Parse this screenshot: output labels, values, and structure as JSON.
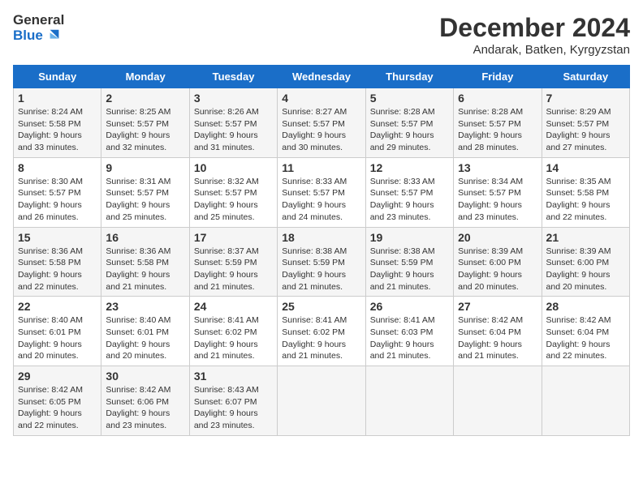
{
  "logo": {
    "line1": "General",
    "line2": "Blue"
  },
  "title": "December 2024",
  "location": "Andarak, Batken, Kyrgyzstan",
  "days_of_week": [
    "Sunday",
    "Monday",
    "Tuesday",
    "Wednesday",
    "Thursday",
    "Friday",
    "Saturday"
  ],
  "weeks": [
    [
      {
        "day": "1",
        "sunrise": "Sunrise: 8:24 AM",
        "sunset": "Sunset: 5:58 PM",
        "daylight": "Daylight: 9 hours and 33 minutes."
      },
      {
        "day": "2",
        "sunrise": "Sunrise: 8:25 AM",
        "sunset": "Sunset: 5:57 PM",
        "daylight": "Daylight: 9 hours and 32 minutes."
      },
      {
        "day": "3",
        "sunrise": "Sunrise: 8:26 AM",
        "sunset": "Sunset: 5:57 PM",
        "daylight": "Daylight: 9 hours and 31 minutes."
      },
      {
        "day": "4",
        "sunrise": "Sunrise: 8:27 AM",
        "sunset": "Sunset: 5:57 PM",
        "daylight": "Daylight: 9 hours and 30 minutes."
      },
      {
        "day": "5",
        "sunrise": "Sunrise: 8:28 AM",
        "sunset": "Sunset: 5:57 PM",
        "daylight": "Daylight: 9 hours and 29 minutes."
      },
      {
        "day": "6",
        "sunrise": "Sunrise: 8:28 AM",
        "sunset": "Sunset: 5:57 PM",
        "daylight": "Daylight: 9 hours and 28 minutes."
      },
      {
        "day": "7",
        "sunrise": "Sunrise: 8:29 AM",
        "sunset": "Sunset: 5:57 PM",
        "daylight": "Daylight: 9 hours and 27 minutes."
      }
    ],
    [
      {
        "day": "8",
        "sunrise": "Sunrise: 8:30 AM",
        "sunset": "Sunset: 5:57 PM",
        "daylight": "Daylight: 9 hours and 26 minutes."
      },
      {
        "day": "9",
        "sunrise": "Sunrise: 8:31 AM",
        "sunset": "Sunset: 5:57 PM",
        "daylight": "Daylight: 9 hours and 25 minutes."
      },
      {
        "day": "10",
        "sunrise": "Sunrise: 8:32 AM",
        "sunset": "Sunset: 5:57 PM",
        "daylight": "Daylight: 9 hours and 25 minutes."
      },
      {
        "day": "11",
        "sunrise": "Sunrise: 8:33 AM",
        "sunset": "Sunset: 5:57 PM",
        "daylight": "Daylight: 9 hours and 24 minutes."
      },
      {
        "day": "12",
        "sunrise": "Sunrise: 8:33 AM",
        "sunset": "Sunset: 5:57 PM",
        "daylight": "Daylight: 9 hours and 23 minutes."
      },
      {
        "day": "13",
        "sunrise": "Sunrise: 8:34 AM",
        "sunset": "Sunset: 5:57 PM",
        "daylight": "Daylight: 9 hours and 23 minutes."
      },
      {
        "day": "14",
        "sunrise": "Sunrise: 8:35 AM",
        "sunset": "Sunset: 5:58 PM",
        "daylight": "Daylight: 9 hours and 22 minutes."
      }
    ],
    [
      {
        "day": "15",
        "sunrise": "Sunrise: 8:36 AM",
        "sunset": "Sunset: 5:58 PM",
        "daylight": "Daylight: 9 hours and 22 minutes."
      },
      {
        "day": "16",
        "sunrise": "Sunrise: 8:36 AM",
        "sunset": "Sunset: 5:58 PM",
        "daylight": "Daylight: 9 hours and 21 minutes."
      },
      {
        "day": "17",
        "sunrise": "Sunrise: 8:37 AM",
        "sunset": "Sunset: 5:59 PM",
        "daylight": "Daylight: 9 hours and 21 minutes."
      },
      {
        "day": "18",
        "sunrise": "Sunrise: 8:38 AM",
        "sunset": "Sunset: 5:59 PM",
        "daylight": "Daylight: 9 hours and 21 minutes."
      },
      {
        "day": "19",
        "sunrise": "Sunrise: 8:38 AM",
        "sunset": "Sunset: 5:59 PM",
        "daylight": "Daylight: 9 hours and 21 minutes."
      },
      {
        "day": "20",
        "sunrise": "Sunrise: 8:39 AM",
        "sunset": "Sunset: 6:00 PM",
        "daylight": "Daylight: 9 hours and 20 minutes."
      },
      {
        "day": "21",
        "sunrise": "Sunrise: 8:39 AM",
        "sunset": "Sunset: 6:00 PM",
        "daylight": "Daylight: 9 hours and 20 minutes."
      }
    ],
    [
      {
        "day": "22",
        "sunrise": "Sunrise: 8:40 AM",
        "sunset": "Sunset: 6:01 PM",
        "daylight": "Daylight: 9 hours and 20 minutes."
      },
      {
        "day": "23",
        "sunrise": "Sunrise: 8:40 AM",
        "sunset": "Sunset: 6:01 PM",
        "daylight": "Daylight: 9 hours and 20 minutes."
      },
      {
        "day": "24",
        "sunrise": "Sunrise: 8:41 AM",
        "sunset": "Sunset: 6:02 PM",
        "daylight": "Daylight: 9 hours and 21 minutes."
      },
      {
        "day": "25",
        "sunrise": "Sunrise: 8:41 AM",
        "sunset": "Sunset: 6:02 PM",
        "daylight": "Daylight: 9 hours and 21 minutes."
      },
      {
        "day": "26",
        "sunrise": "Sunrise: 8:41 AM",
        "sunset": "Sunset: 6:03 PM",
        "daylight": "Daylight: 9 hours and 21 minutes."
      },
      {
        "day": "27",
        "sunrise": "Sunrise: 8:42 AM",
        "sunset": "Sunset: 6:04 PM",
        "daylight": "Daylight: 9 hours and 21 minutes."
      },
      {
        "day": "28",
        "sunrise": "Sunrise: 8:42 AM",
        "sunset": "Sunset: 6:04 PM",
        "daylight": "Daylight: 9 hours and 22 minutes."
      }
    ],
    [
      {
        "day": "29",
        "sunrise": "Sunrise: 8:42 AM",
        "sunset": "Sunset: 6:05 PM",
        "daylight": "Daylight: 9 hours and 22 minutes."
      },
      {
        "day": "30",
        "sunrise": "Sunrise: 8:42 AM",
        "sunset": "Sunset: 6:06 PM",
        "daylight": "Daylight: 9 hours and 23 minutes."
      },
      {
        "day": "31",
        "sunrise": "Sunrise: 8:43 AM",
        "sunset": "Sunset: 6:07 PM",
        "daylight": "Daylight: 9 hours and 23 minutes."
      },
      null,
      null,
      null,
      null
    ]
  ],
  "accent_color": "#1a6ec8"
}
